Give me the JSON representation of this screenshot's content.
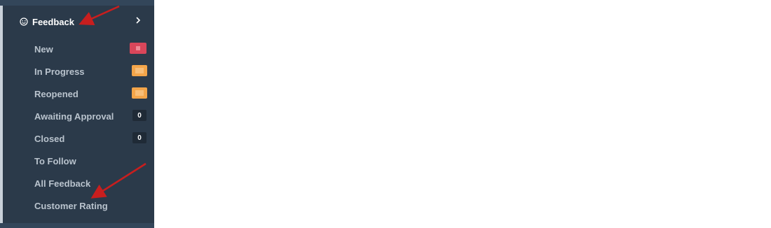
{
  "sidebar": {
    "header": {
      "label": "Feedback",
      "icon": "smile-icon"
    },
    "items": [
      {
        "label": "New",
        "badge": "",
        "badge_style": "red"
      },
      {
        "label": "In Progress",
        "badge": "",
        "badge_style": "orange"
      },
      {
        "label": "Reopened",
        "badge": "",
        "badge_style": "orange"
      },
      {
        "label": "Awaiting Approval",
        "badge": "0",
        "badge_style": "dark"
      },
      {
        "label": "Closed",
        "badge": "0",
        "badge_style": "dark"
      },
      {
        "label": "To Follow"
      },
      {
        "label": "All Feedback"
      },
      {
        "label": "Customer Rating"
      }
    ]
  },
  "colors": {
    "sidebar_bg": "#2b3a4a",
    "text_muted": "#b9c3cd",
    "badge_red": "#d9465a",
    "badge_orange": "#f3a54a",
    "annotation_arrow": "#c81e1e"
  }
}
